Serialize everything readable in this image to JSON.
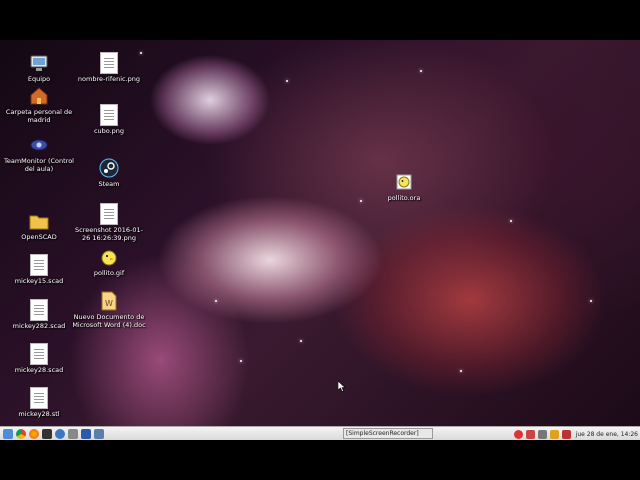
{
  "desktop": {
    "icons": [
      {
        "label": "Equipo",
        "icon": "computer-icon"
      },
      {
        "label": "Carpeta personal de madrid",
        "icon": "home-folder-icon"
      },
      {
        "label": "TeamMonitor (Control del aula)",
        "icon": "team-monitor-icon"
      },
      {
        "label": "OpenSCAD",
        "icon": "folder-icon"
      },
      {
        "label": "mickey15.scad",
        "icon": "document-icon"
      },
      {
        "label": "mickey282.scad",
        "icon": "document-icon"
      },
      {
        "label": "mickey28.scad",
        "icon": "document-icon"
      },
      {
        "label": "mickey28.stl",
        "icon": "document-icon"
      },
      {
        "label": "nombre-rifenic.png",
        "icon": "image-file-icon"
      },
      {
        "label": "cubo.png",
        "icon": "image-file-icon"
      },
      {
        "label": "Steam",
        "icon": "steam-icon"
      },
      {
        "label": "Screenshot 2016-01-26 16:26:39.png",
        "icon": "image-file-icon"
      },
      {
        "label": "pollito.gif",
        "icon": "gif-icon"
      },
      {
        "label": "Nuevo Documento de Microsoft Word (4).doc",
        "icon": "word-document-icon"
      },
      {
        "label": "pollito.ora",
        "icon": "ora-file-icon"
      }
    ]
  },
  "taskbar": {
    "window_button": "[SimpleScreenRecorder]",
    "clock": "jue 28 de ene, 14:26",
    "launchers": [
      "file-manager-icon",
      "chrome-icon",
      "firefox-icon",
      "terminal-icon",
      "browser-icon",
      "settings-icon",
      "virtualbox-icon",
      "desktop-icon"
    ],
    "tray": [
      "recording-icon",
      "network-icon",
      "volume-icon",
      "battery-icon",
      "updates-icon"
    ]
  }
}
